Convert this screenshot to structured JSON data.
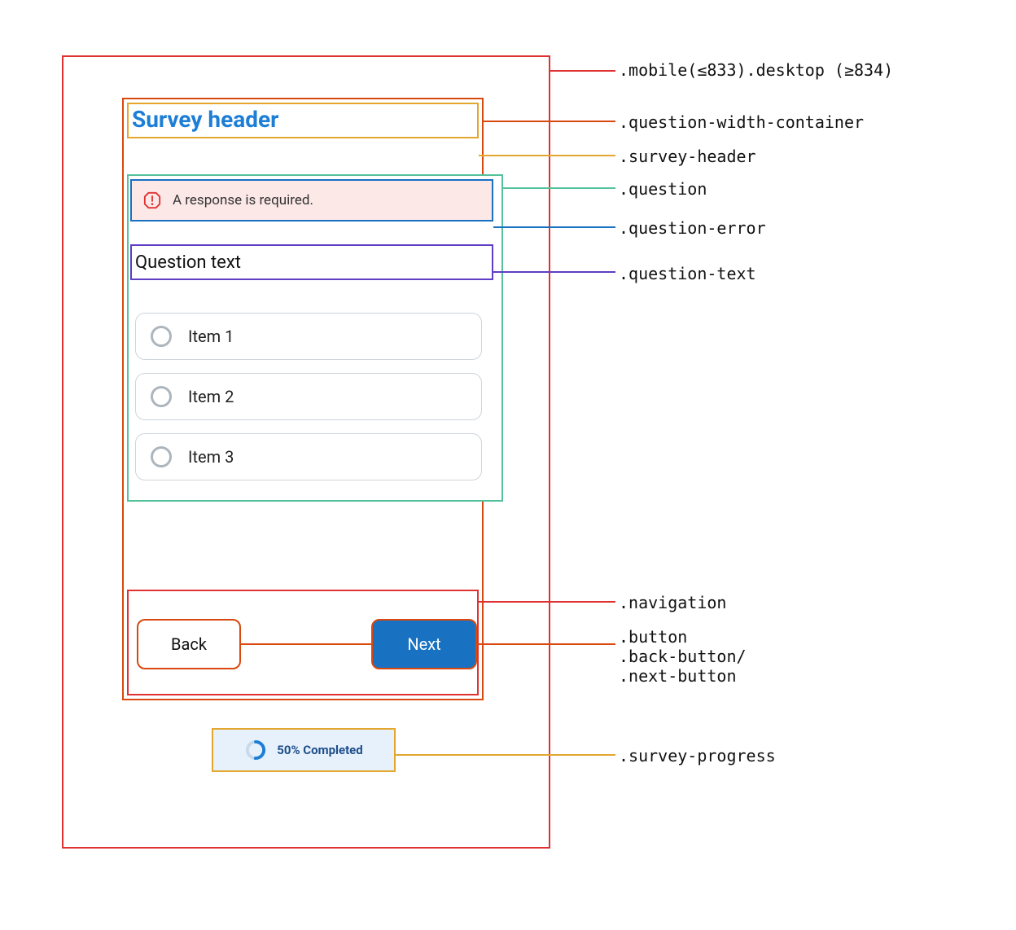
{
  "annotations": {
    "mobile_desktop": ".mobile(≤833).desktop (≥834)",
    "question_width_container": ".question-width-container",
    "survey_header": ".survey-header",
    "question": ".question",
    "question_error": ".question-error",
    "question_text": ".question-text",
    "navigation": ".navigation",
    "button_line1": ".button",
    "button_line2": ".back-button/",
    "button_line3": ".next-button",
    "survey_progress": ".survey-progress"
  },
  "survey": {
    "header": "Survey header",
    "error_message": "A response is required.",
    "question_text": "Question text",
    "items": [
      "Item 1",
      "Item 2",
      "Item 3"
    ],
    "back_label": "Back",
    "next_label": "Next",
    "progress_text": "50% Completed",
    "progress_percent": 50
  },
  "colors": {
    "red": "#e03131",
    "orange": "#d9480f",
    "yellow": "#e3a72f",
    "teal": "#55c19b",
    "blue": "#1971c2",
    "purple": "#5f3dc4"
  }
}
